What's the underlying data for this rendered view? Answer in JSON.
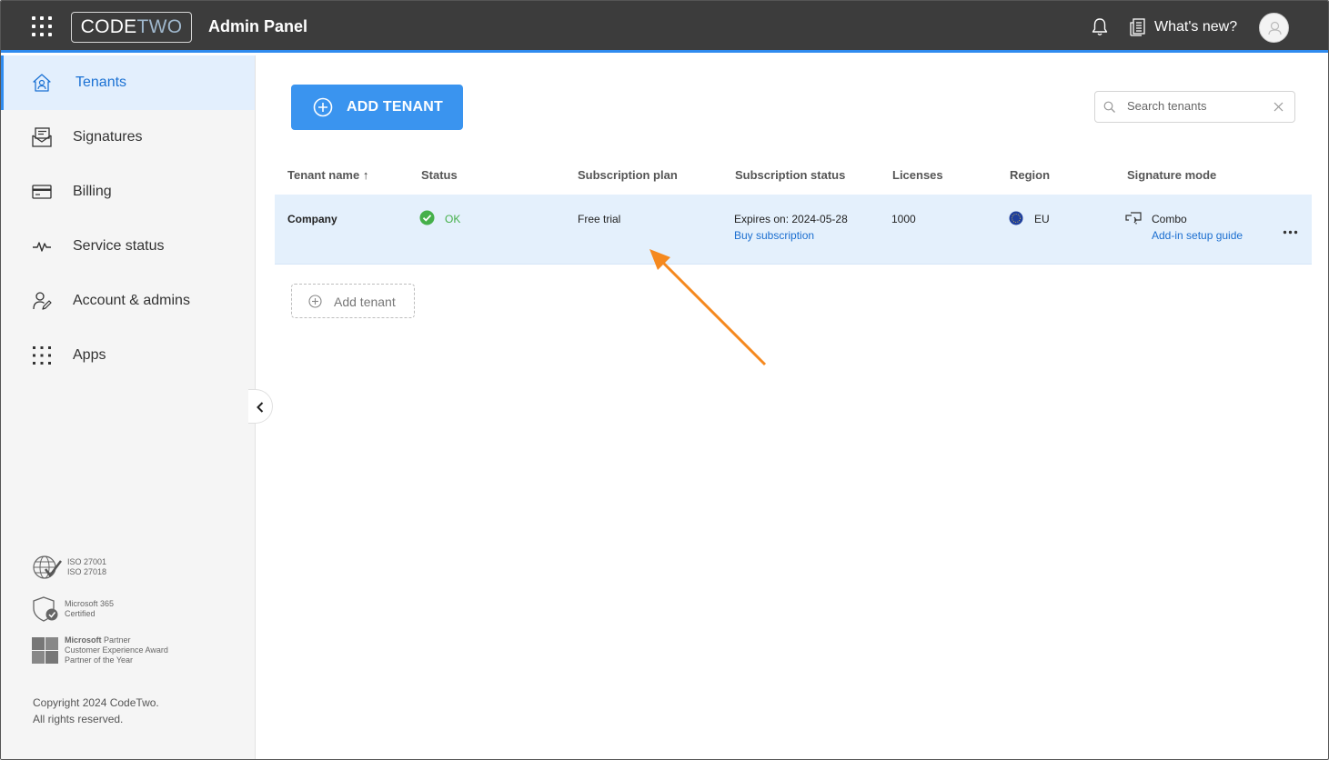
{
  "header": {
    "logo_code": "CODE",
    "logo_two": "TWO",
    "app_title": "Admin Panel",
    "whats_new": "What's new?",
    "accent_color": "#2f8bef"
  },
  "sidebar": {
    "items": [
      {
        "label": "Tenants",
        "icon": "house-person-icon",
        "active": true
      },
      {
        "label": "Signatures",
        "icon": "signature-envelope-icon"
      },
      {
        "label": "Billing",
        "icon": "credit-card-icon"
      },
      {
        "label": "Service status",
        "icon": "pulse-icon"
      },
      {
        "label": "Account & admins",
        "icon": "user-edit-icon"
      },
      {
        "label": "Apps",
        "icon": "apps-grid-icon"
      }
    ],
    "certs": {
      "iso": [
        "ISO 27001",
        "ISO 27018"
      ],
      "ms365": [
        "Microsoft 365",
        "Certified"
      ],
      "partner_bold": "Microsoft",
      "partner_rest": "Partner",
      "partner_lines": [
        "Customer Experience Award",
        "Partner of the Year"
      ]
    },
    "copyright": [
      "Copyright 2024 CodeTwo.",
      "All rights reserved."
    ]
  },
  "main": {
    "add_tenant_button": "ADD TENANT",
    "search_placeholder": "Search tenants",
    "columns": [
      "Tenant name",
      "Status",
      "Subscription plan",
      "Subscription status",
      "Licenses",
      "Region",
      "Signature mode"
    ],
    "sort_indicator": "↑",
    "row": {
      "tenant_name": "Company",
      "status": "OK",
      "plan": "Free trial",
      "subscription_status": "Expires on: 2024-05-28",
      "buy_link": "Buy subscription",
      "licenses": "1000",
      "region": "EU",
      "signature_mode": "Combo",
      "setup_link": "Add-in setup guide"
    },
    "add_tenant_link": "Add tenant",
    "annotation_color": "#f5891f"
  }
}
